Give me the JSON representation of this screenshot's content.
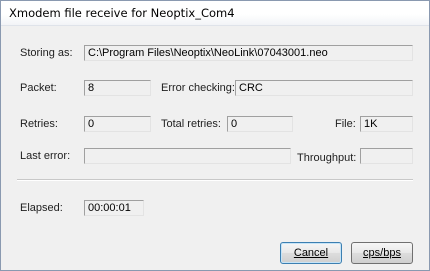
{
  "window": {
    "title": "Xmodem file receive for Neoptix_Com4"
  },
  "fields": {
    "storing_as": {
      "label": "Storing as:",
      "value": "C:\\Program Files\\Neoptix\\NeoLink\\07043001.neo"
    },
    "packet": {
      "label": "Packet:",
      "value": "8"
    },
    "error_checking": {
      "label": "Error checking:",
      "value": "CRC"
    },
    "retries": {
      "label": "Retries:",
      "value": "0"
    },
    "total_retries": {
      "label": "Total retries:",
      "value": "0"
    },
    "file": {
      "label": "File:",
      "value": "1K"
    },
    "last_error": {
      "label": "Last error:",
      "value": ""
    },
    "throughput": {
      "label": "Throughput:",
      "value": ""
    },
    "elapsed": {
      "label": "Elapsed:",
      "value": "00:00:01"
    }
  },
  "buttons": {
    "cancel": "Cancel",
    "cps_bps": "cps/bps"
  }
}
